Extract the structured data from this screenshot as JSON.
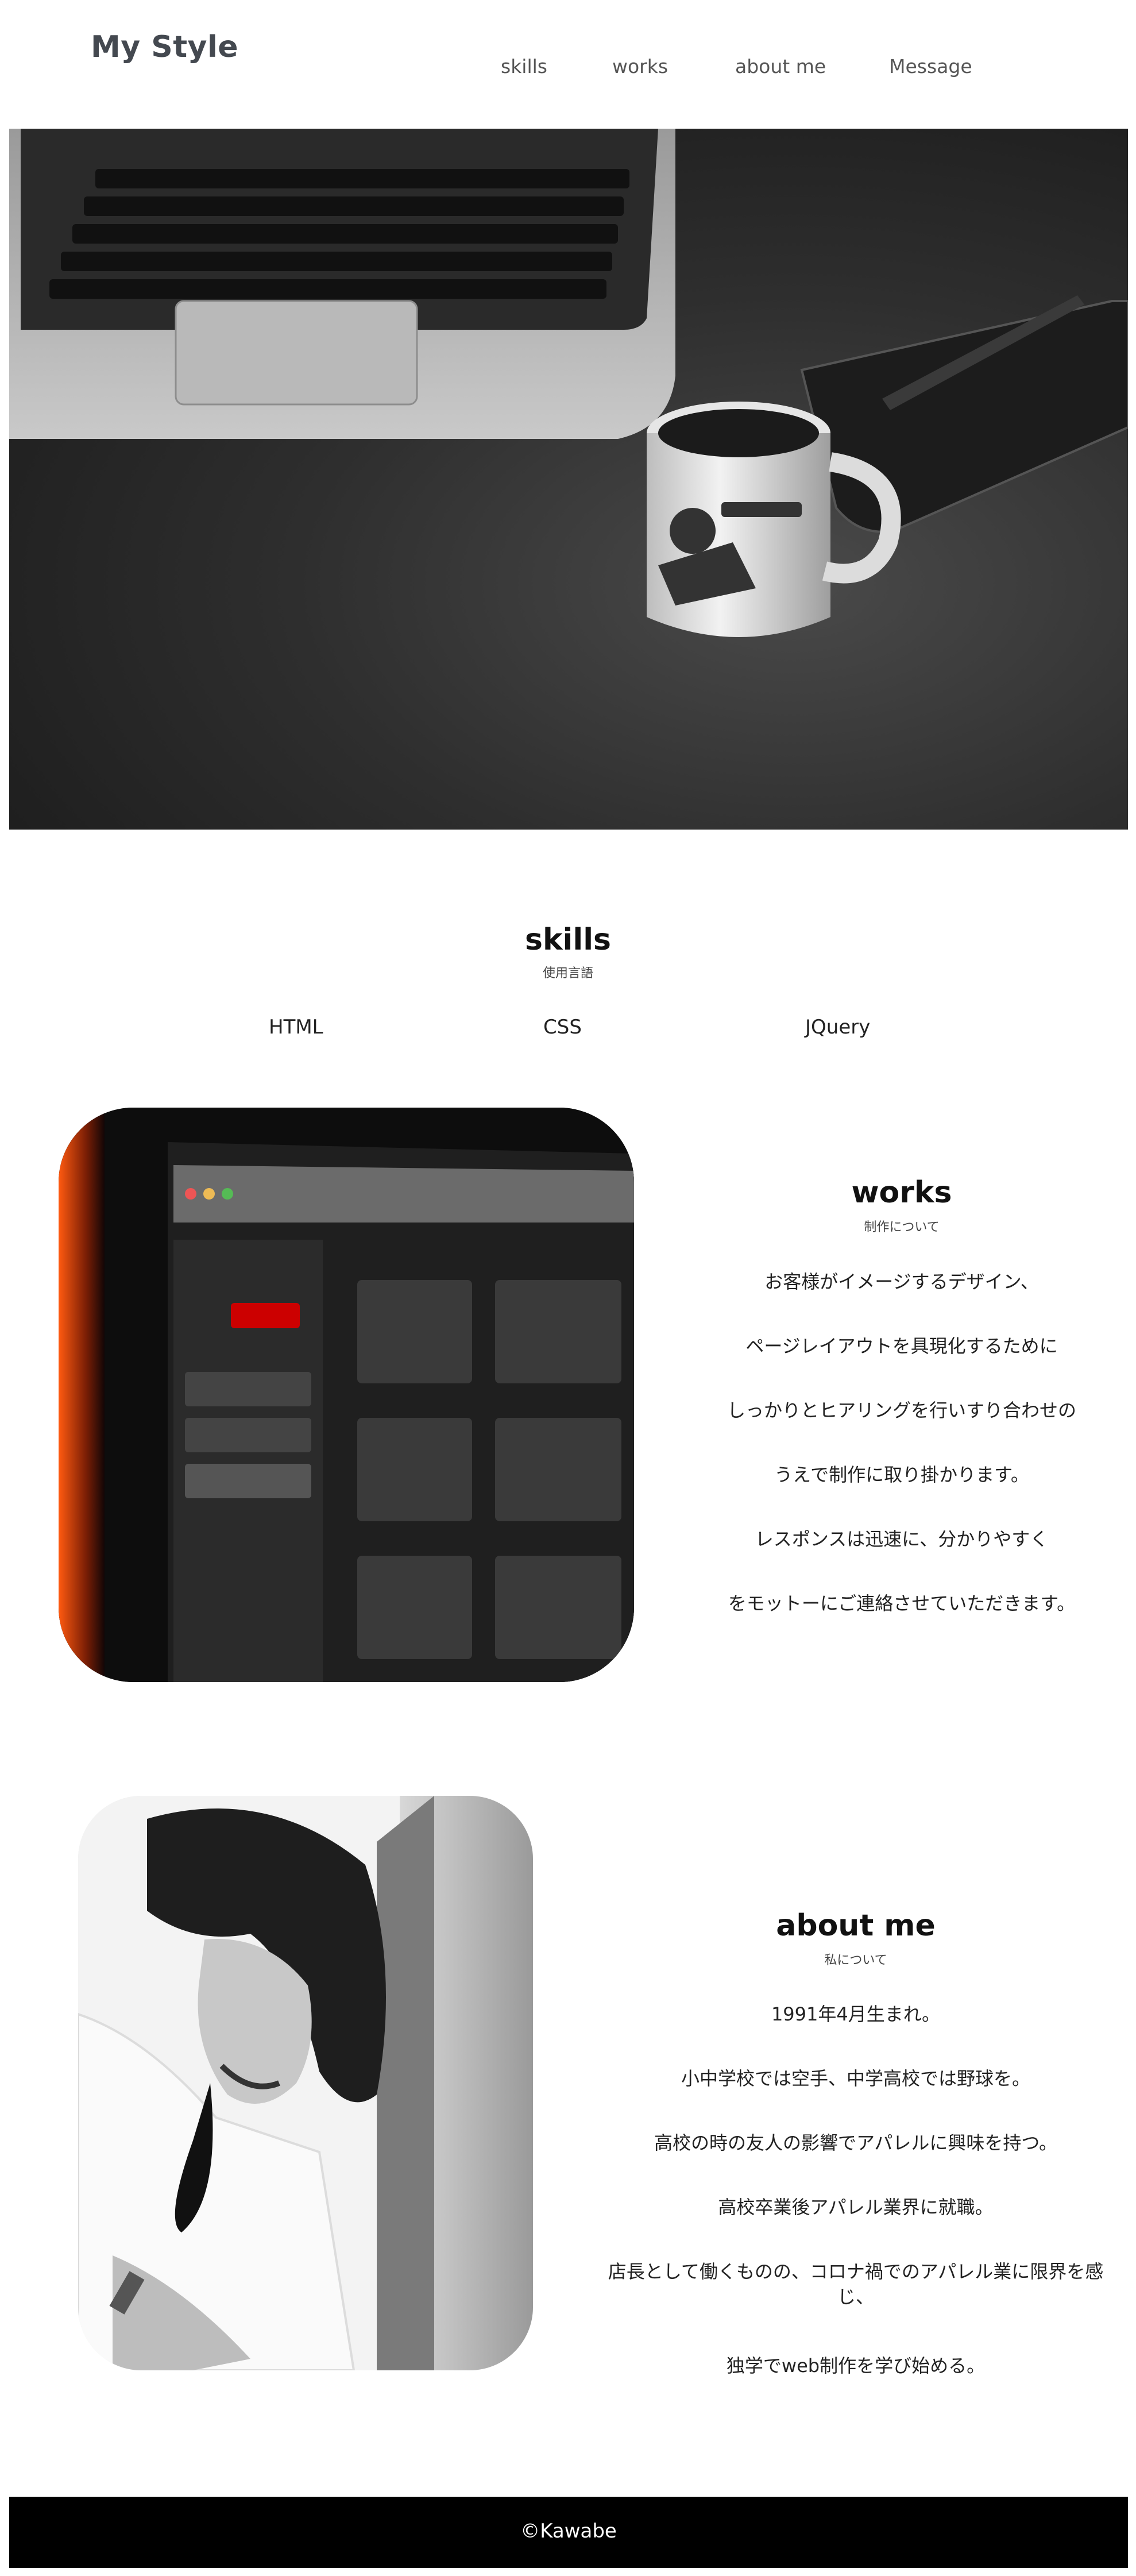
{
  "header": {
    "site_title": "My Style",
    "nav": {
      "skills": "skills",
      "works": "works",
      "about": "about me",
      "message": "Message"
    }
  },
  "skills": {
    "title": "skills",
    "subtitle": "使用言語",
    "items": [
      "HTML",
      "CSS",
      "JQuery"
    ]
  },
  "works": {
    "title": "works",
    "subtitle": "制作について",
    "lines": [
      "お客様がイメージするデザイン、",
      "ページレイアウトを具現化するために",
      "しっかりとヒアリングを行いすり合わせの",
      "うえで制作に取り掛かります。",
      "レスポンスは迅速に、分かりやすく",
      "をモットーにご連絡させていただきます。"
    ]
  },
  "about": {
    "title": "about me",
    "subtitle": "私について",
    "lines": [
      "1991年4月生まれ。",
      "小中学校では空手、中学高校では野球を。",
      "高校の時の友人の影響でアパレルに興味を持つ。",
      "高校卒業後アパレル業界に就職。",
      "店長として働くものの、コロナ禍でのアパレル業に限界を感じ、",
      "独学でweb制作を学び始める。"
    ]
  },
  "footer": {
    "copyright": "©Kawabe"
  }
}
